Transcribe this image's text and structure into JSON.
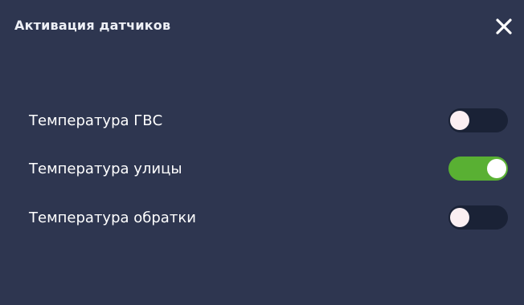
{
  "dialog": {
    "title": "Активация датчиков",
    "close_icon": "close-icon"
  },
  "sensors": [
    {
      "label": "Температура ГВС",
      "enabled": false
    },
    {
      "label": "Температура улицы",
      "enabled": true
    },
    {
      "label": "Температура обратки",
      "enabled": false
    }
  ],
  "colors": {
    "background": "#2e3650",
    "toggle_off_track": "#1a2236",
    "toggle_on_track": "#59b033",
    "knob": "#fbeff2"
  }
}
